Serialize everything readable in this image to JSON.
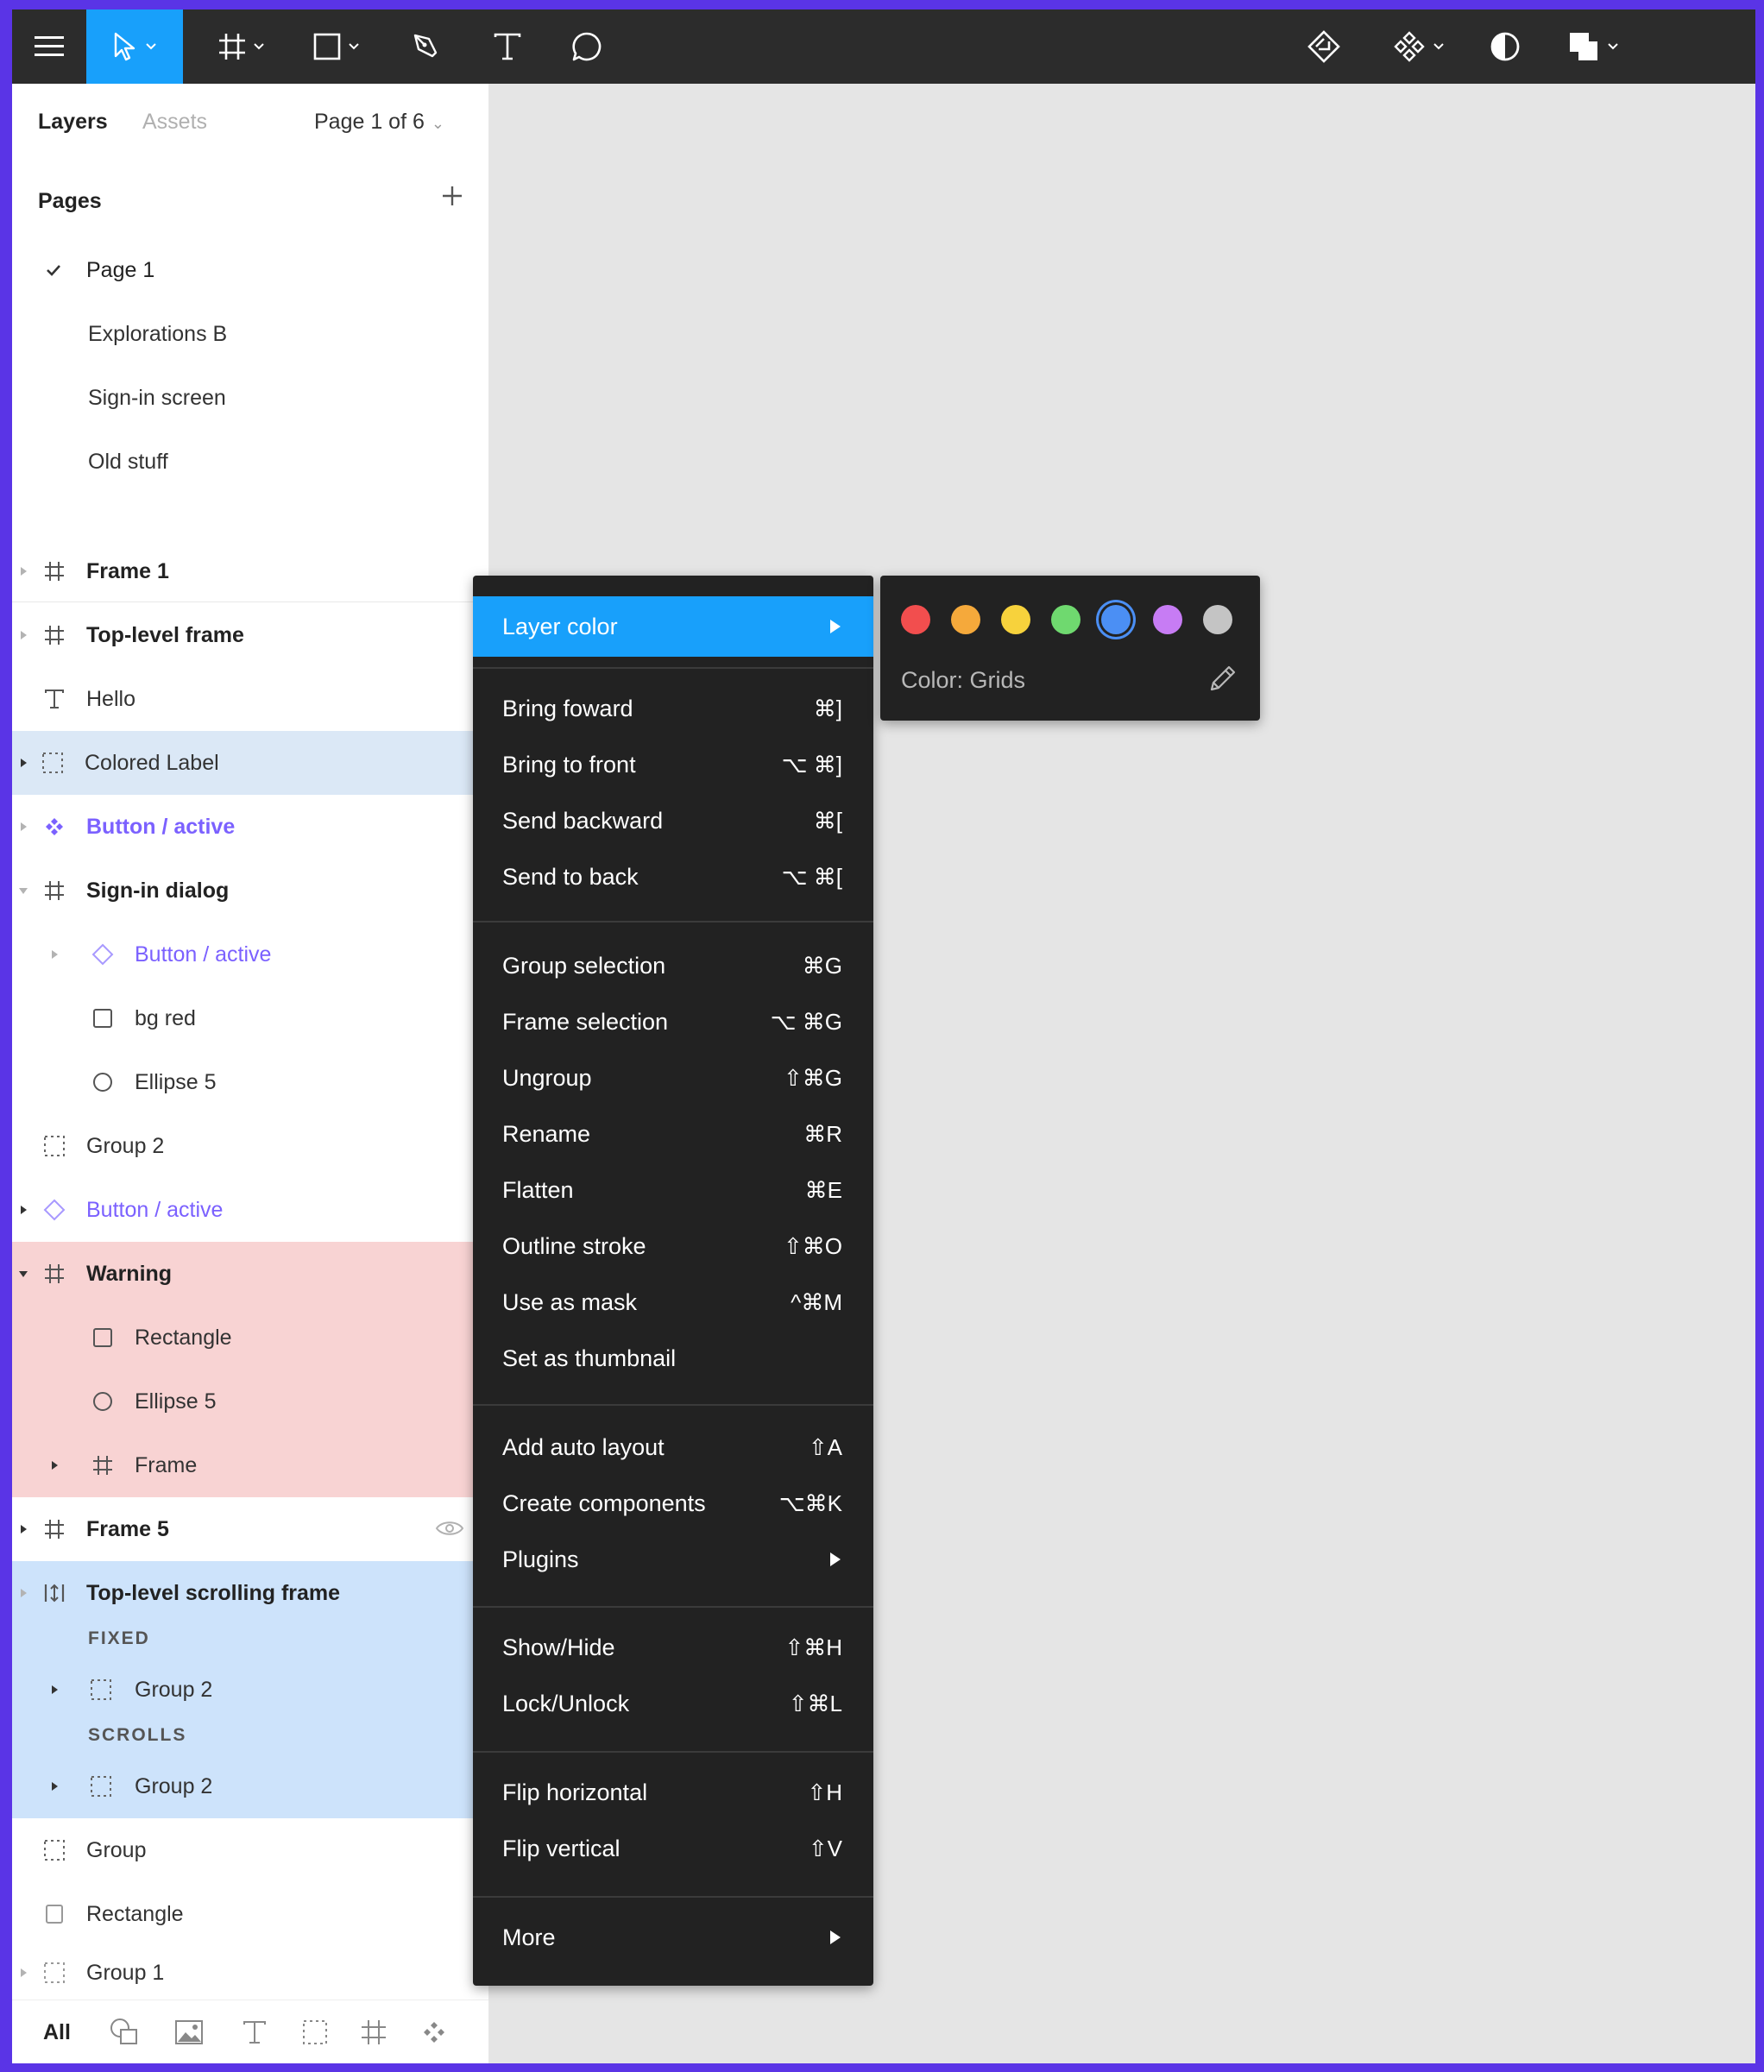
{
  "toolbar": {
    "tools": [
      "menu-icon",
      "move-tool-icon",
      "frame-tool-icon",
      "shape-tool-icon",
      "pen-tool-icon",
      "text-tool-icon",
      "comment-tool-icon"
    ],
    "right_tools": [
      "component-instance-icon",
      "components-icon",
      "mask-icon",
      "boolean-ops-icon"
    ]
  },
  "panel": {
    "tab_layers": "Layers",
    "tab_assets": "Assets",
    "page_selector": "Page 1 of 6",
    "pages_header": "Pages",
    "pages": [
      "Page 1",
      "Explorations B",
      "Sign-in screen",
      "Old stuff"
    ],
    "layers": {
      "frame1": "Frame 1",
      "top_level_frame": "Top-level frame",
      "hello": "Hello",
      "colored_label": "Colored Label",
      "button_active_1": "Button / active",
      "signin_dialog": "Sign-in dialog",
      "button_active_2": "Button / active",
      "bg_red": "bg red",
      "ellipse5_a": "Ellipse 5",
      "group2_a": "Group 2",
      "button_active_3": "Button / active",
      "warning": "Warning",
      "rectangle_a": "Rectangle",
      "ellipse5_b": "Ellipse 5",
      "frame_a": "Frame",
      "frame5": "Frame 5",
      "top_scroll_frame": "Top-level scrolling frame",
      "fixed": "FIXED",
      "group2_b": "Group 2",
      "scrolls": "SCROLLS",
      "group2_c": "Group 2",
      "group": "Group",
      "rectangle_b": "Rectangle",
      "group1": "Group 1"
    },
    "filter_all": "All"
  },
  "context_menu": {
    "layer_color": "Layer color",
    "items": [
      {
        "label": "Bring foward",
        "shortcut": "⌘]"
      },
      {
        "label": "Bring to front",
        "shortcut": "⌥ ⌘]"
      },
      {
        "label": "Send backward",
        "shortcut": "⌘["
      },
      {
        "label": "Send to back",
        "shortcut": "⌥ ⌘["
      },
      {
        "label": "Group selection",
        "shortcut": "⌘G"
      },
      {
        "label": "Frame selection",
        "shortcut": "⌥ ⌘G"
      },
      {
        "label": "Ungroup",
        "shortcut": "⇧⌘G"
      },
      {
        "label": "Rename",
        "shortcut": "⌘R"
      },
      {
        "label": "Flatten",
        "shortcut": "⌘E"
      },
      {
        "label": "Outline stroke",
        "shortcut": "⇧⌘O"
      },
      {
        "label": "Use as mask",
        "shortcut": "^⌘M"
      },
      {
        "label": "Set as thumbnail",
        "shortcut": ""
      },
      {
        "label": "Add auto layout",
        "shortcut": "⇧A"
      },
      {
        "label": "Create components",
        "shortcut": "⌥⌘K"
      },
      {
        "label": "Plugins",
        "shortcut": ""
      },
      {
        "label": "Show/Hide",
        "shortcut": "⇧⌘H"
      },
      {
        "label": "Lock/Unlock",
        "shortcut": "⇧⌘L"
      },
      {
        "label": "Flip horizontal",
        "shortcut": "⇧H"
      },
      {
        "label": "Flip vertical",
        "shortcut": "⇧V"
      },
      {
        "label": "More",
        "shortcut": ""
      }
    ]
  },
  "color_submenu": {
    "swatches": [
      "#f24e4e",
      "#f5a93b",
      "#f7d23c",
      "#6fd96f",
      "#4b8ff4",
      "#c77cf4",
      "#c4c4c4"
    ],
    "selected_index": 4,
    "label": "Color: Grids"
  }
}
